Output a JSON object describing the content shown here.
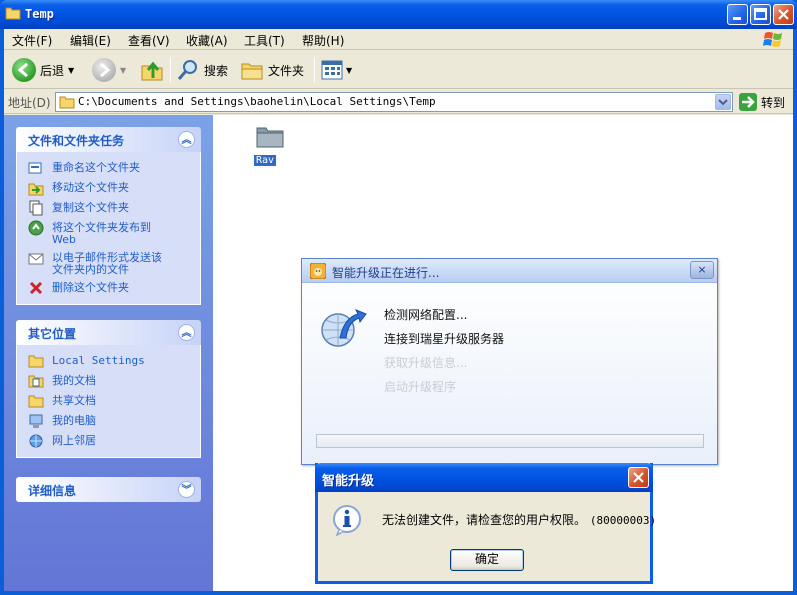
{
  "window": {
    "title": "Temp"
  },
  "menu": [
    "文件(F)",
    "编辑(E)",
    "查看(V)",
    "收藏(A)",
    "工具(T)",
    "帮助(H)"
  ],
  "toolbar": {
    "back": "后退",
    "search": "搜索",
    "folders": "文件夹"
  },
  "address": {
    "label": "地址(D)",
    "value": "C:\\Documents and Settings\\baohelin\\Local Settings\\Temp",
    "go": "转到"
  },
  "left": {
    "tasks": {
      "title": "文件和文件夹任务",
      "items": [
        "重命名这个文件夹",
        "移动这个文件夹",
        "复制这个文件夹",
        "将这个文件夹发布到",
        "Web",
        "以电子邮件形式发送该",
        "文件夹内的文件",
        "删除这个文件夹"
      ]
    },
    "places": {
      "title": "其它位置",
      "items": [
        "Local Settings",
        "我的文档",
        "共享文档",
        "我的电脑",
        "网上邻居"
      ]
    },
    "details": {
      "title": "详细信息"
    }
  },
  "content": {
    "folder": "Rav"
  },
  "progress": {
    "title": "智能升级正在进行...",
    "close": "×",
    "steps": [
      "检测网络配置...",
      "连接到瑞星升级服务器",
      "获取升级信息...",
      "启动升级程序"
    ]
  },
  "error": {
    "title": "智能升级",
    "message": "无法创建文件，请检查您的用户权限。",
    "code": "(80000003)",
    "ok": "确定"
  }
}
